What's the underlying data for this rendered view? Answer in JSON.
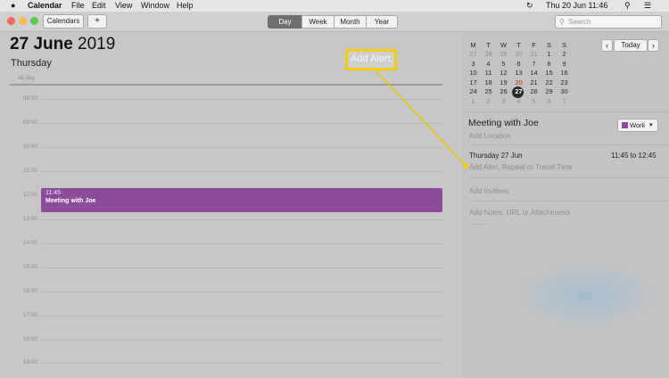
{
  "menubar": {
    "app": "Calendar",
    "items": [
      "File",
      "Edit",
      "View",
      "Window",
      "Help"
    ],
    "clock": "Thu 20 Jun  11:46"
  },
  "toolbar": {
    "calendars_label": "Calendars",
    "add_label": "+",
    "views": [
      "Day",
      "Week",
      "Month",
      "Year"
    ],
    "active_view": "Day",
    "search_placeholder": "Search"
  },
  "day": {
    "date_bold": "27 June",
    "date_year": "2019",
    "weekday": "Thursday",
    "all_day_label": "all-day",
    "hours": [
      "09:00",
      "10:00",
      "11:00",
      "12:00",
      "13:00",
      "14:00",
      "15:00",
      "16:00",
      "17:00",
      "18:00",
      "19:00"
    ],
    "early_hour": "08:00",
    "event": {
      "time": "11:45",
      "title": "Meeting with Joe",
      "color": "#8b4c9a"
    }
  },
  "annotation": {
    "callout_text": "Add Alert,",
    "border_color": "#f3cf00",
    "line_color": "#e9c700"
  },
  "mini_calendar": {
    "weekday_headers": [
      "M",
      "T",
      "W",
      "T",
      "F",
      "S",
      "S"
    ],
    "weeks": [
      [
        "27",
        "28",
        "29",
        "30",
        "31",
        "1",
        "2"
      ],
      [
        "3",
        "4",
        "5",
        "6",
        "7",
        "8",
        "9"
      ],
      [
        "10",
        "11",
        "12",
        "13",
        "14",
        "15",
        "16"
      ],
      [
        "17",
        "18",
        "19",
        "20",
        "21",
        "22",
        "23"
      ],
      [
        "24",
        "25",
        "26",
        "27",
        "28",
        "29",
        "30"
      ],
      [
        "1",
        "2",
        "3",
        "4",
        "5",
        "6",
        "7"
      ]
    ],
    "today_button": "Today",
    "prev_icon": "chevron-left",
    "next_icon": "chevron-right"
  },
  "inspector": {
    "title": "Meeting with Joe",
    "calendar_label": "Work",
    "calendar_color": "#8b4c9a",
    "location_placeholder": "Add Location",
    "date": "Thursday 27 Jun",
    "time_range": "11:45 to 12:45",
    "alert_placeholder": "Add Alert, Repeat or Travel Time",
    "invitees_placeholder": "Add Invitees",
    "notes_placeholder": "Add Notes, URL or Attachments"
  }
}
